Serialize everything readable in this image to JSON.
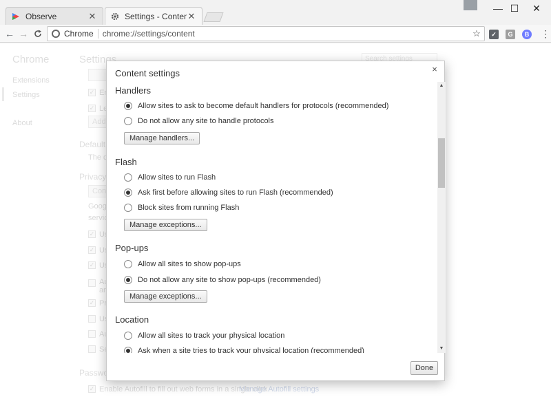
{
  "tabs": [
    {
      "title": "Observe",
      "active": false
    },
    {
      "title": "Settings - Content settings",
      "active": true
    }
  ],
  "window_controls": {
    "minimize": "—",
    "maximize": "☐",
    "close": "✕"
  },
  "toolbar": {
    "back": "←",
    "forward": "→",
    "reload": "C",
    "chip": "Chrome",
    "url": "chrome://settings/content",
    "star": "☆",
    "ext_g": "G",
    "ext_b": "B",
    "menu": "⋮"
  },
  "background_page": {
    "sidebar_title": "Chrome",
    "sidebar_items": [
      "Extensions",
      "Settings",
      "About"
    ],
    "page_title": "Settings",
    "search_placeholder": "Search settings",
    "fragments": {
      "en": "En",
      "le": "Le",
      "add": "Add",
      "default": "Default b",
      "the_de": "The de",
      "privacy": "Privacy",
      "con": "Con",
      "google": "Google",
      "service": "service",
      "us1": "Us",
      "us2": "Us",
      "us3": "Us",
      "au": "Au",
      "an": "an",
      "pr": "Pr",
      "us4": "Us",
      "au2": "Au",
      "se": "Se",
      "passwords": "Passwo",
      "autofill": "Enable Autofill to fill out web forms in a single click.",
      "autofill_link": "Manage Autofill settings"
    }
  },
  "dialog": {
    "title": "Content settings",
    "close": "×",
    "done": "Done",
    "sections": {
      "handlers": {
        "heading": "Handlers",
        "opt1": "Allow sites to ask to become default handlers for protocols (recommended)",
        "opt2": "Do not allow any site to handle protocols",
        "button": "Manage handlers..."
      },
      "flash": {
        "heading": "Flash",
        "opt1": "Allow sites to run Flash",
        "opt2": "Ask first before allowing sites to run Flash (recommended)",
        "opt3": "Block sites from running Flash",
        "button": "Manage exceptions..."
      },
      "popups": {
        "heading": "Pop-ups",
        "opt1": "Allow all sites to show pop-ups",
        "opt2": "Do not allow any site to show pop-ups (recommended)",
        "button": "Manage exceptions..."
      },
      "location": {
        "heading": "Location",
        "opt1": "Allow all sites to track your physical location",
        "opt2": "Ask when a site tries to track your physical location (recommended)"
      }
    },
    "scroll_up": "▲",
    "scroll_down": "▼"
  }
}
